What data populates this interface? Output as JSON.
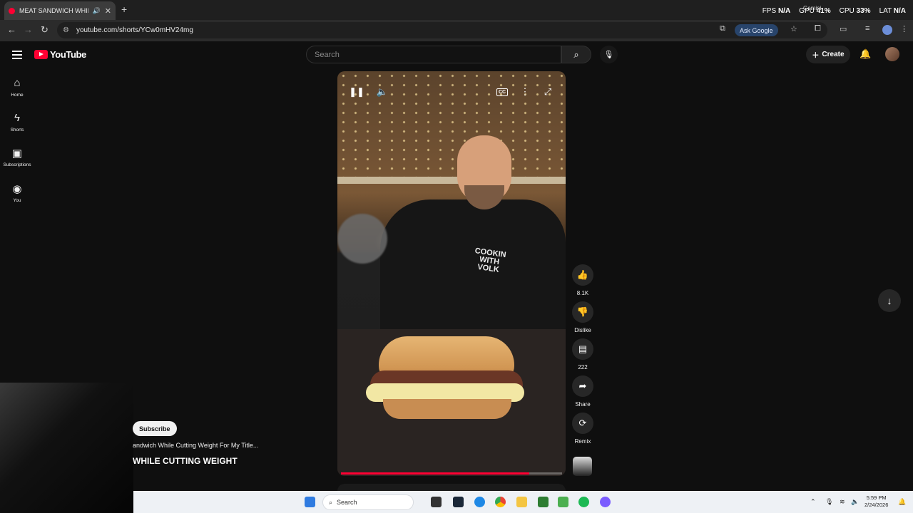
{
  "browser": {
    "tab_title": "MEAT SANDWICH WHILE CUTTING WEIGHT",
    "new_tab": "+",
    "url": "youtube.com/shorts/YCw0mHV24mg",
    "ask_google": "Ask Google",
    "gemini": "Gemini"
  },
  "overlay": {
    "fps_label": "FPS",
    "fps_value": "N/A",
    "gpu_label": "GPU",
    "gpu_value": "41%",
    "cpu_label": "CPU",
    "cpu_value": "33%",
    "lat_label": "LAT",
    "lat_value": "N/A"
  },
  "youtube": {
    "logo_text": "YouTube",
    "search_placeholder": "Search",
    "create_label": "Create",
    "rail": [
      {
        "label": "Home",
        "icon": "home-icon"
      },
      {
        "label": "Shorts",
        "icon": "shorts-icon"
      },
      {
        "label": "Subscriptions",
        "icon": "subscriptions-icon"
      },
      {
        "label": "You",
        "icon": "you-icon"
      }
    ]
  },
  "video": {
    "shirt_text": "COOKIN WITH VOLK",
    "progress_fraction": 0.85
  },
  "actions": {
    "like_count": "8.1K",
    "dislike_label": "Dislike",
    "comment_count": "222",
    "share_label": "Share",
    "remix_label": "Remix"
  },
  "info": {
    "subscribe_label": "Subscribe",
    "description": "andwich While Cutting Weight For My Title...",
    "title": "WHILE CUTTING WEIGHT"
  },
  "taskbar": {
    "search_label": "Search",
    "time": "5:59 PM",
    "date": "2/24/2026"
  }
}
